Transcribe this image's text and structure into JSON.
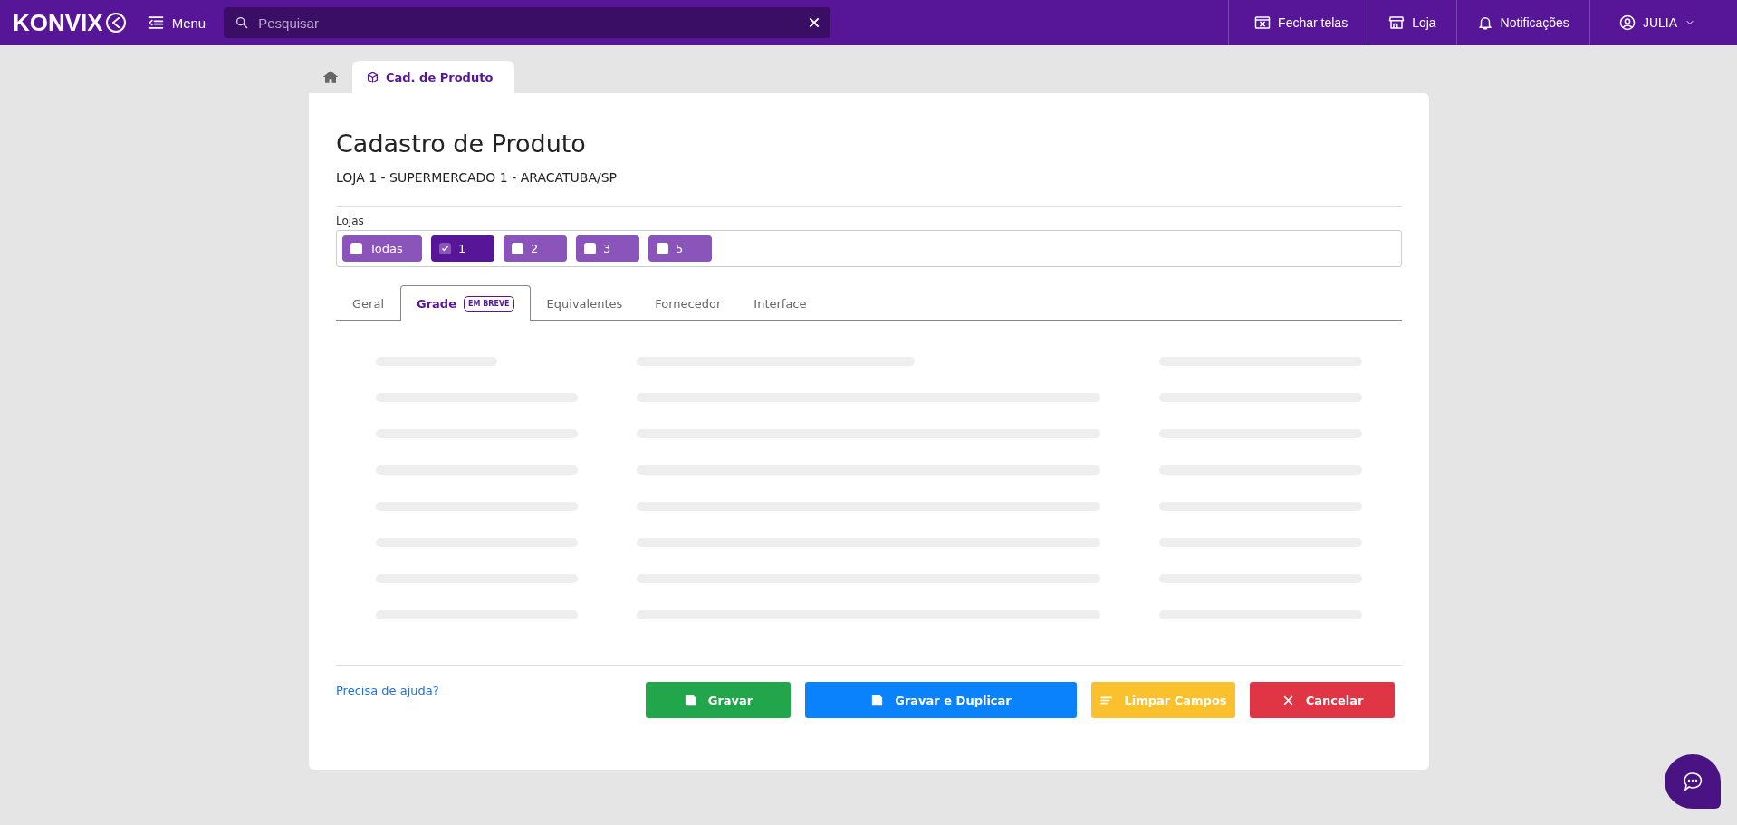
{
  "topbar": {
    "logo": "KONVIX",
    "menu": "Menu",
    "search": {
      "placeholder": "Pesquisar"
    },
    "actions": [
      {
        "kind": "close-screens",
        "label": "Fechar telas"
      },
      {
        "kind": "store",
        "label": "Loja"
      },
      {
        "kind": "notifications",
        "label": "Notificações"
      },
      {
        "kind": "user",
        "label": "JULIA"
      }
    ]
  },
  "page_tabs": [
    {
      "kind": "home",
      "selected": false
    },
    {
      "kind": "product",
      "label": "Cad. de Produto",
      "selected": true
    }
  ],
  "title": "Cadastro de Produto",
  "subtitle": "LOJA 1 - SUPERMERCADO 1 - ARACATUBA/SP",
  "stores": {
    "label": "Lojas",
    "items": [
      {
        "label": "Todas",
        "checked": false
      },
      {
        "label": "1",
        "checked": true
      },
      {
        "label": "2",
        "checked": false
      },
      {
        "label": "3",
        "checked": false
      },
      {
        "label": "5",
        "checked": false
      }
    ]
  },
  "tabs": [
    {
      "label": "Geral",
      "selected": false
    },
    {
      "label": "Grade",
      "selected": true,
      "badge": "EM BREVE"
    },
    {
      "label": "Equivalentes",
      "selected": false
    },
    {
      "label": "Fornecedor",
      "selected": false
    },
    {
      "label": "Interface",
      "selected": false
    }
  ],
  "help_link": "Precisa de ajuda?",
  "buttons": [
    {
      "kind": "save",
      "label": "Gravar"
    },
    {
      "kind": "save-duplicate",
      "label": "Gravar e Duplicar"
    },
    {
      "kind": "clear",
      "label": "Limpar Campos"
    },
    {
      "kind": "cancel",
      "label": "Cancelar"
    }
  ]
}
